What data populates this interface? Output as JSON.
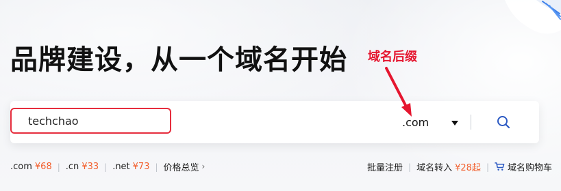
{
  "headline": "品牌建设，从一个域名开始",
  "annotation": {
    "label": "域名后缀",
    "color": "#e5162f"
  },
  "search": {
    "value": "techchao",
    "suffix": ".com",
    "search_icon": "search-icon",
    "dropdown_icon": "chevron-down-icon"
  },
  "prices": [
    {
      "ext": ".com",
      "price": "¥68"
    },
    {
      "ext": ".cn",
      "price": "¥33"
    },
    {
      "ext": ".net",
      "price": "¥73"
    }
  ],
  "price_overview": {
    "label": "价格总览",
    "icon": "chevron-right-icon"
  },
  "actions": {
    "bulk_register": "批量注册",
    "transfer_label": "域名转入",
    "transfer_price": "¥28起",
    "cart_label": "域名购物车",
    "cart_icon": "shopping-cart-icon"
  },
  "colors": {
    "accent_blue": "#2b59c3",
    "price_orange": "#f25f2d",
    "annotation_red": "#e5162f"
  }
}
